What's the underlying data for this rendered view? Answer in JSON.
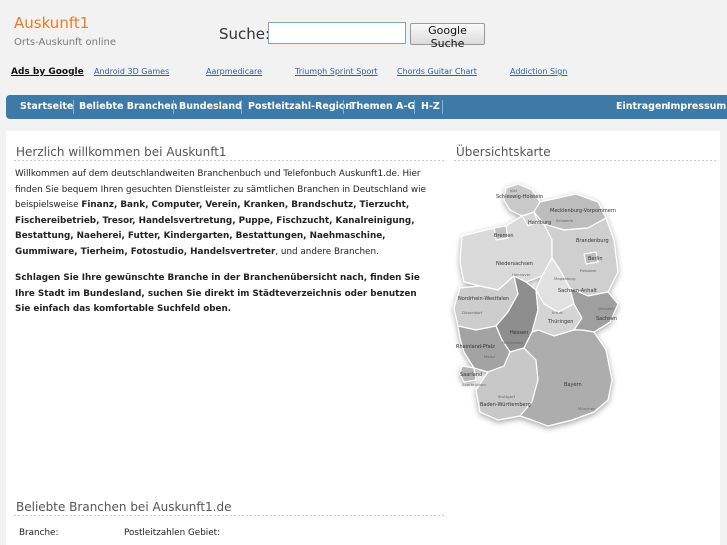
{
  "site": {
    "name": "Auskunft1",
    "tagline": "Orts-Auskunft online"
  },
  "search": {
    "label": "Suche:",
    "value": "",
    "button": "Google Suche"
  },
  "ads": {
    "label": "Ads by Google",
    "links": [
      "Android 3D Games",
      "Aarpmedicare",
      "Triumph Sprint Sport",
      "Chords Guitar Chart",
      "Addiction Sign"
    ]
  },
  "nav": {
    "left": [
      "Startseite",
      "Beliebte Branchen",
      "Bundesland",
      "Postleitzahl-Region",
      "Themen A-G",
      "H-Z"
    ],
    "right": [
      "Eintragen",
      "Impressum"
    ]
  },
  "welcome": {
    "title": "Herzlich willkommen bei Auskunft1",
    "intro": "Willkommen auf dem deutschlandweiten Branchenbuch und Telefonbuch Auskunft1.de. Hier finden Sie bequem Ihren gesuchten Dienstleister zu sämtlichen Branchen in Deutschland wie beispielsweise",
    "examples": "Finanz, Bank, Computer, Verein, Kranken, Brandschutz, Tierzucht, Fischereibetrieb, Tresor, Handelsvertretung, Puppe, Fischzucht, Kanalreinigung, Bestattung, Naeherei, Futter, Kindergarten, Bestattungen, Naehmaschine, Gummiware, Tierheim, Fotostudio, Handelsvertreter",
    "outro": ", und andere Branchen.",
    "cta": "Schlagen Sie Ihre gewünschte Branche in der Branchenübersicht nach, finden Sie Ihre Stadt im Bundesland, suchen Sie direkt im Städteverzeichnis oder benutzen Sie einfach das komfortable Suchfeld oben."
  },
  "map": {
    "title": "Übersichtskarte",
    "states": {
      "sh": "Schleswig-Holstein",
      "mv": "Mecklenburg-Vorpommern",
      "hh": "Hamburg",
      "hb": "Bremen",
      "ni": "Niedersachsen",
      "bb": "Brandenburg",
      "be": "Berlin",
      "st": "Sachsen-Anhalt",
      "nw": "Nordrhein-Westfalen",
      "he": "Hessen",
      "th": "Thüringen",
      "sn": "Sachsen",
      "rp": "Rheinland-Pfalz",
      "sl": "Saarland",
      "bw": "Baden-Württemberg",
      "by": "Bayern"
    },
    "cities": {
      "hannover": "Hannover",
      "magdeburg": "Magdeburg",
      "duesseldorf": "Düsseldorf",
      "dresden": "Dresden",
      "erfurt": "Erfurt",
      "wiesbaden": "Wiesbaden",
      "mainz": "Mainz",
      "stuttgart": "Stuttgart",
      "muenchen": "München",
      "saarbruecken": "Saarbrücken",
      "kiel": "Kiel",
      "schwerin": "Schwerin",
      "potsdam": "Potsdam"
    }
  },
  "popular": {
    "title": "Beliebte Branchen bei Auskunft1.de",
    "col_branche": "Branche:",
    "col_plz": "Postleitzahlen Gebiet:"
  },
  "colors": {
    "accent": "#e37c2c",
    "nav": "#3d7aa7",
    "link": "#2b5fa8"
  }
}
